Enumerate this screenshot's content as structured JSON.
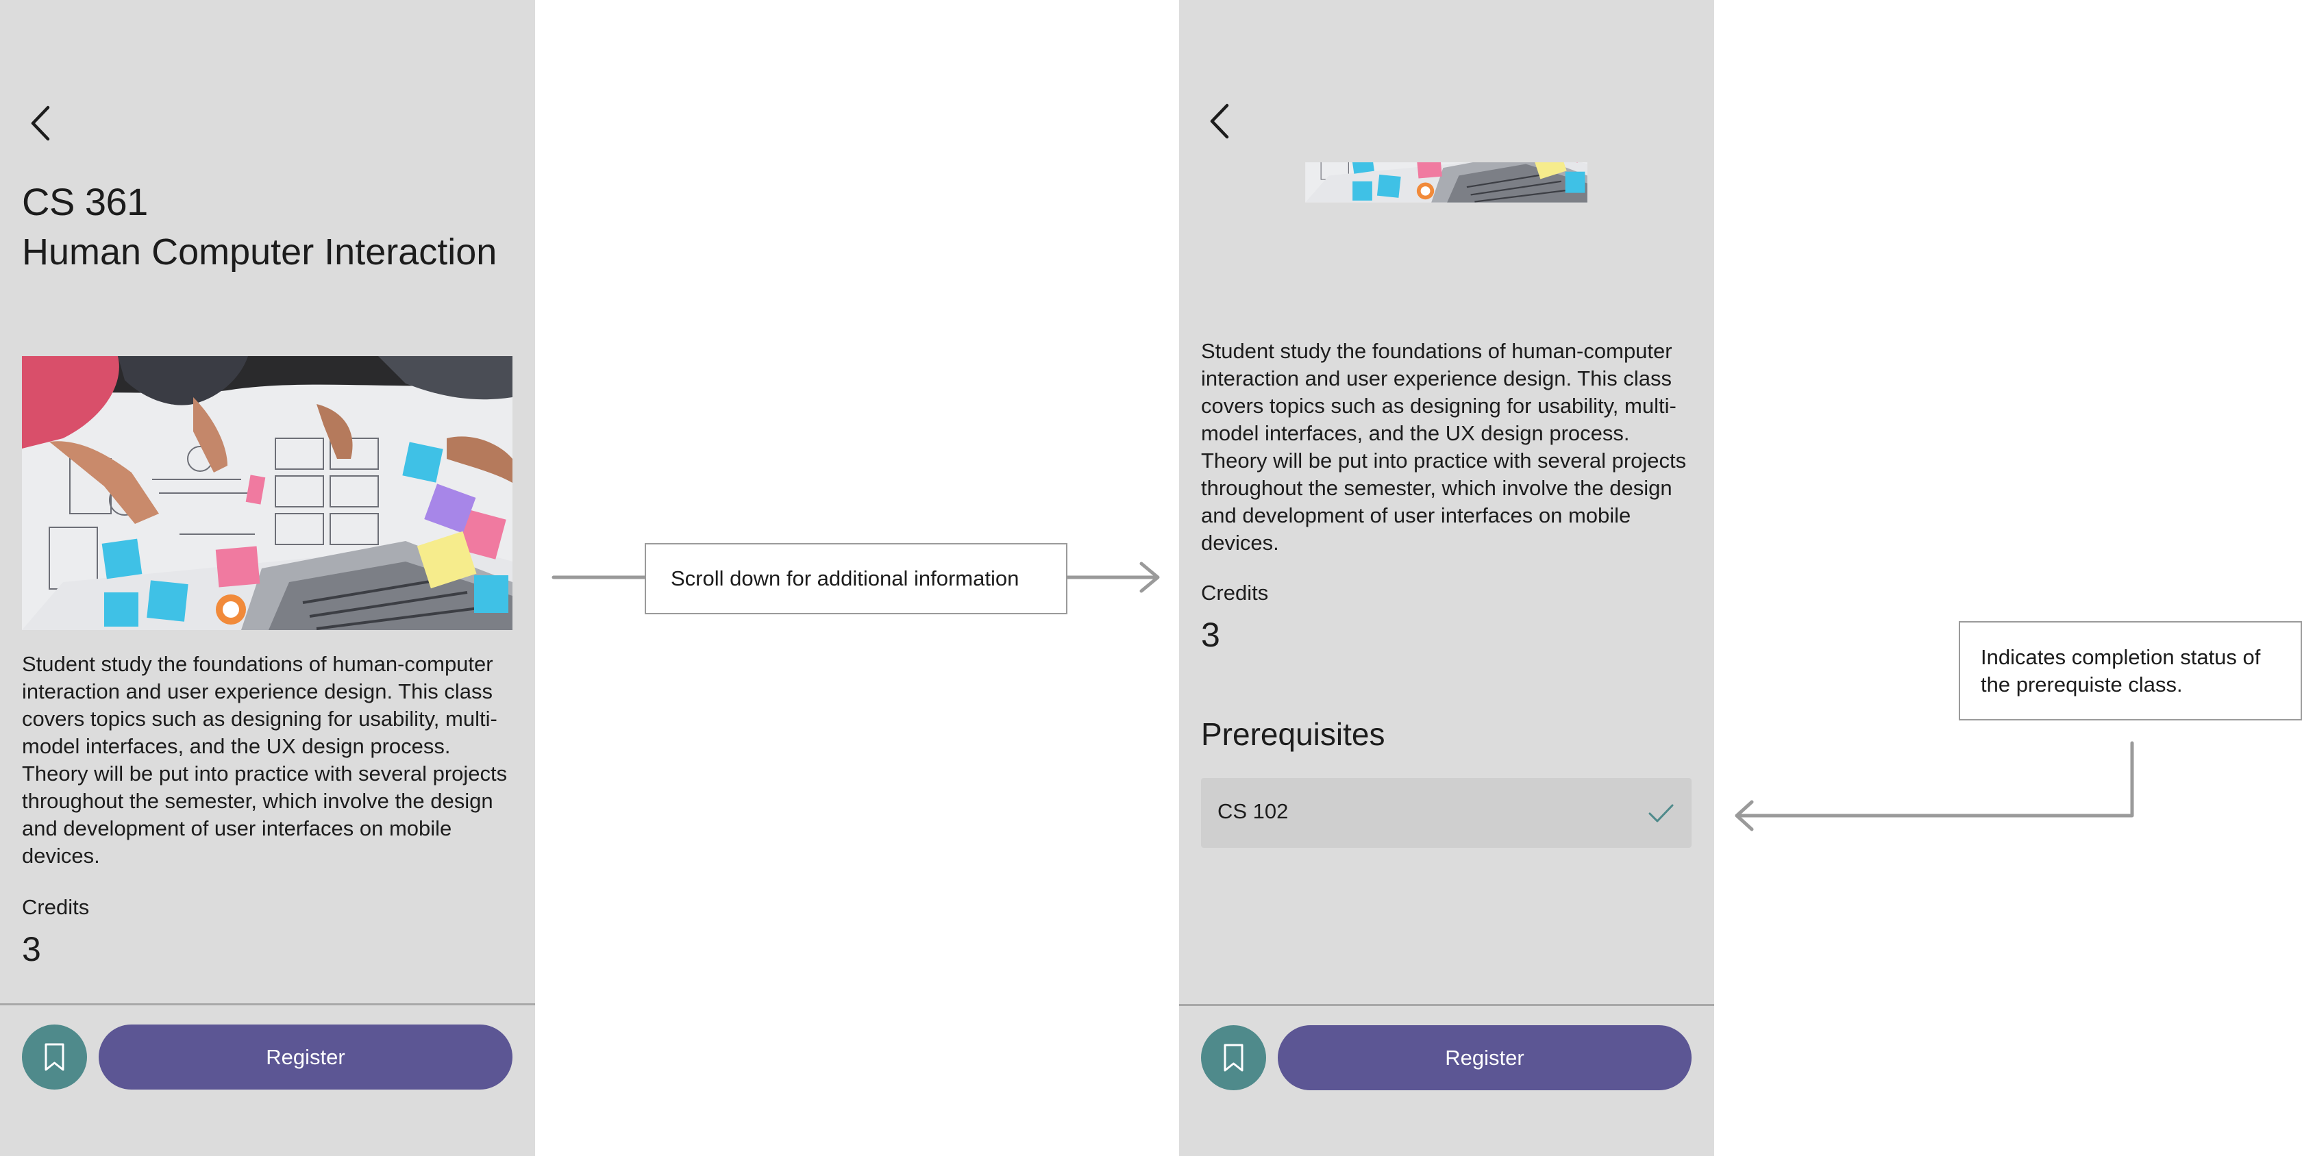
{
  "screen_initial": {
    "course_code": "CS 361",
    "course_title": "Human Computer Interaction",
    "description": "Student study the foundations of human-computer interaction and user experience design. This class covers topics such as designing for usability, multi-model interfaces, and the UX design process. Theory will be put into practice with several projects throughout the semester, which involve the design and development of user interfaces on mobile devices.",
    "credits_label": "Credits",
    "credits_value": "3",
    "register_label": "Register"
  },
  "screen_scrolled": {
    "description": "Student study the foundations of human-computer interaction and user experience design. This class covers topics such as designing for usability, multi-model interfaces, and the UX design process. Theory will be put into practice with several projects throughout the semester, which involve the design and development of user interfaces on mobile devices.",
    "credits_label": "Credits",
    "credits_value": "3",
    "prerequisites_heading": "Prerequisites",
    "prerequisites": [
      {
        "code": "CS 102",
        "status_icon": "checkmark-icon",
        "completed": true
      }
    ],
    "register_label": "Register"
  },
  "annotations": {
    "scroll_note": "Scroll down for additional information",
    "status_note": "Indicates completion status of the prerequiste class."
  },
  "icons": {
    "back": "chevron-left-icon",
    "bookmark": "bookmark-icon",
    "check": "checkmark-icon"
  },
  "colors": {
    "screen_background": "#dcdcdc",
    "register_button": "#5c5694",
    "bookmark_button": "#4f8a8b",
    "prerequisite_row": "#cfcfcf",
    "check_icon": "#4f8a8b",
    "connector_line": "#9a9a9a"
  }
}
